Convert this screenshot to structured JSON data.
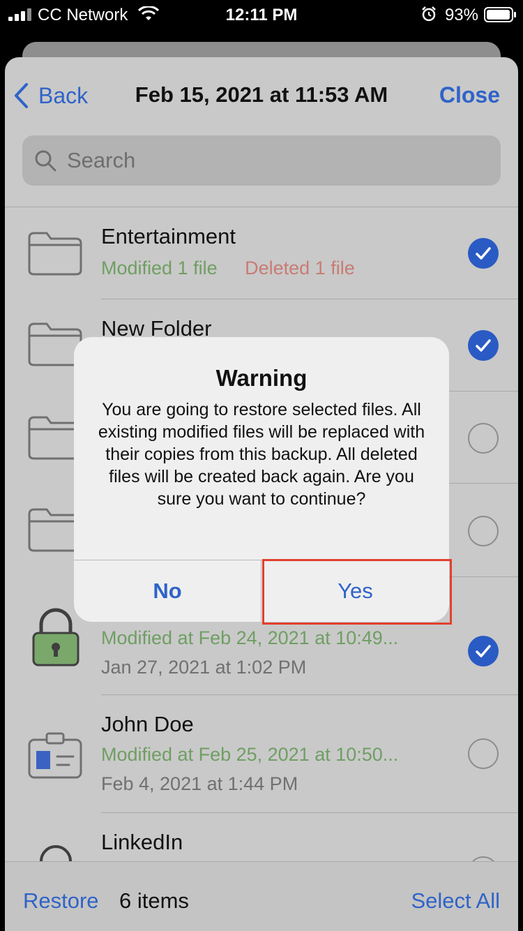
{
  "status_bar": {
    "carrier": "CC Network",
    "time": "12:11 PM",
    "battery": "93%"
  },
  "nav": {
    "back_label": "Back",
    "title": "Feb 15, 2021 at 11:53 AM",
    "close_label": "Close"
  },
  "search": {
    "placeholder": "Search"
  },
  "rows": [
    {
      "name": "Entertainment",
      "modified": "Modified 1 file",
      "deleted": "Deleted 1 file",
      "checked": true,
      "icon": "folder-icon"
    },
    {
      "name": "New Folder",
      "checked": true,
      "icon": "folder-icon"
    },
    {
      "checked": false,
      "icon": "folder-icon"
    },
    {
      "checked": false,
      "icon": "folder-icon"
    },
    {
      "modified": "Modified at Feb 24, 2021 at 10:49...",
      "date": "Jan 27, 2021 at 1:02 PM",
      "checked": true,
      "icon": "lock-icon"
    },
    {
      "name": "John Doe",
      "modified": "Modified at Feb 25, 2021 at 10:50...",
      "date": "Feb 4, 2021 at 1:44 PM",
      "checked": false,
      "icon": "id-card-icon"
    },
    {
      "name": "LinkedIn",
      "checked": false,
      "icon": "key-icon"
    }
  ],
  "toolbar": {
    "restore_label": "Restore",
    "count_label": "6 items",
    "select_all_label": "Select All"
  },
  "alert": {
    "title": "Warning",
    "message": "You are going to restore selected files. All existing modified files will be replaced with their copies from this backup. All deleted files will be created back again. Are you sure you want to continue?",
    "no_label": "No",
    "yes_label": "Yes"
  },
  "colors": {
    "accent": "#2f63c8",
    "highlight": "#e2402e",
    "modified": "#6f9e63",
    "deleted": "#c87c74"
  }
}
